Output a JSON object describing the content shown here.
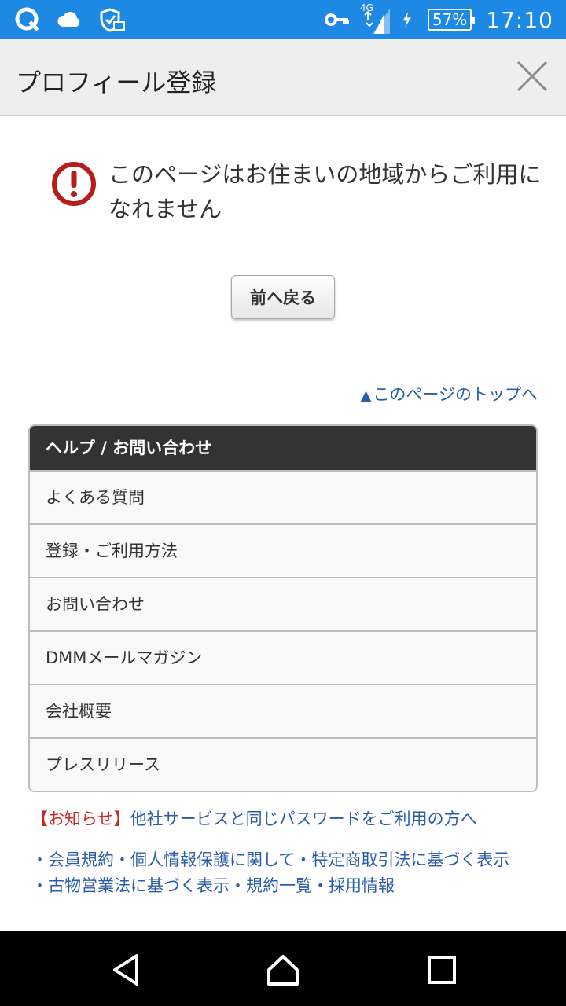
{
  "status_bar": {
    "network": "4G",
    "battery": "57%",
    "time": "17:10",
    "icons": [
      "q-app-icon",
      "cloud-icon",
      "shield-mail-icon",
      "key-icon",
      "signal-icon",
      "charging-icon"
    ]
  },
  "header": {
    "title": "プロフィール登録",
    "close_icon": "close-icon"
  },
  "error": {
    "icon": "alert-icon",
    "message": "このページはお住まいの地域からご利用になれません"
  },
  "back_button": {
    "label": "前へ戻る"
  },
  "top_link": {
    "arrow": "▲",
    "label": "このページのトップへ"
  },
  "help": {
    "title": "ヘルプ / お問い合わせ",
    "items": [
      {
        "label": "よくある質問"
      },
      {
        "label": "登録・ご利用方法"
      },
      {
        "label": "お問い合わせ"
      },
      {
        "label": "DMMメールマガジン"
      },
      {
        "label": "会社概要"
      },
      {
        "label": "プレスリリース"
      }
    ]
  },
  "notice": {
    "tag": "【お知らせ】",
    "text": "他社サービスと同じパスワードをご利用の方へ"
  },
  "footer_links": {
    "line1": "・会員規約・個人情報保護に関して・特定商取引法に基づく表示",
    "line2": "・古物営業法に基づく表示・規約一覧・採用情報"
  },
  "nav": [
    "back-icon",
    "home-icon",
    "recents-icon"
  ],
  "colors": {
    "status_bar": "#1e88e5",
    "link": "#2c5ea8",
    "alert": "#c62828",
    "help_header": "#333333"
  }
}
